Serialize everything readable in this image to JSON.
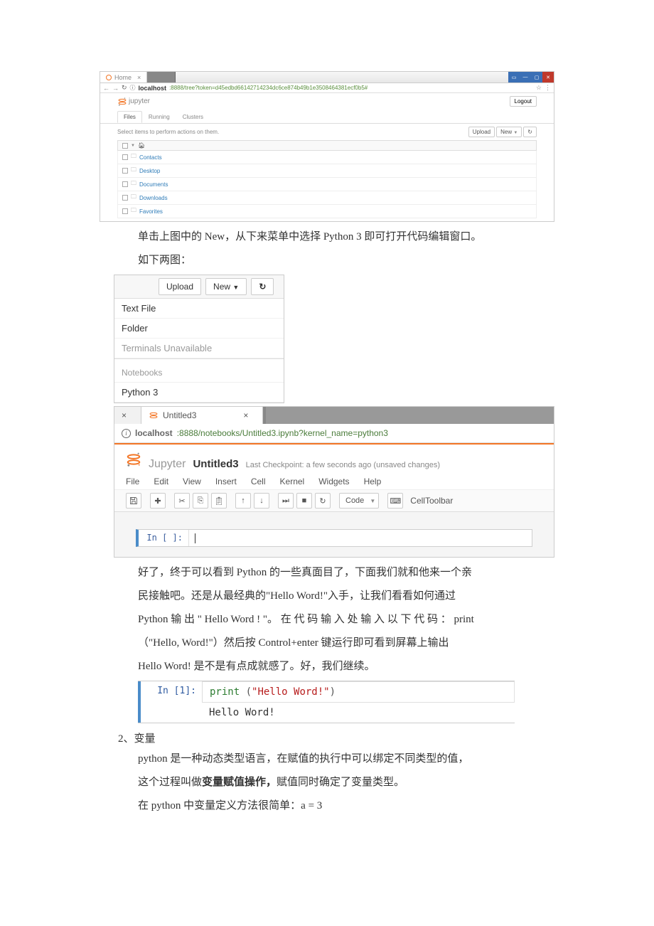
{
  "screenshot1": {
    "browser_tab": "Home",
    "url_label": "localhost",
    "url_rest": ":8888/tree?token=d45edbd66142714234dc6ce874b49b1e3508464381ecf0b5#",
    "logo": "jupyter",
    "logout": "Logout",
    "tabs": [
      "Files",
      "Running",
      "Clusters"
    ],
    "hint": "Select items to perform actions on them.",
    "upload": "Upload",
    "new": "New",
    "rows": [
      "Contacts",
      "Desktop",
      "Documents",
      "Downloads",
      "Favorites"
    ]
  },
  "text1a": "单击上图中的 New，从下来菜单中选择 Python 3 即可打开代码编辑窗口。",
  "text1b": "如下两图：",
  "screenshot2": {
    "upload": "Upload",
    "new": "New",
    "items": [
      "Text File",
      "Folder",
      "Terminals Unavailable"
    ],
    "section": "Notebooks",
    "py": "Python 3"
  },
  "screenshot3": {
    "tab_label": "Untitled3",
    "url_host": "localhost",
    "url_rest": ":8888/notebooks/Untitled3.ipynb?kernel_name=python3",
    "logo": "Jupyter",
    "title": "Untitled3",
    "checkpoint": "Last Checkpoint: a few seconds ago (unsaved changes)",
    "menu": [
      "File",
      "Edit",
      "View",
      "Insert",
      "Cell",
      "Kernel",
      "Widgets",
      "Help"
    ],
    "celltype": "Code",
    "celltoolbar": "CellToolbar",
    "prompt": "In [ ]:"
  },
  "text2a": "好了，终于可以看到 Python 的一些真面目了，下面我们就和他来一个亲",
  "text2b": "民接触吧。还是从最经典的\"Hello Word!\"入手，让我们看看如何通过",
  "text2c": "Python 输 出 \" Hello Word ! \"。 在 代 码 输 入 处 输 入 以 下 代 码 ： print",
  "text2d": "（\"Hello, Word!\"）然后按 Control+enter 键运行即可看到屏幕上输出",
  "text2e": "Hello Word! 是不是有点成就感了。好，我们继续。",
  "screenshot4": {
    "prompt": "In  [1]:",
    "code_fn": "print",
    "code_paren1": " (",
    "code_str": "\"Hello Word!\"",
    "code_paren2": ")",
    "output": "Hello Word!"
  },
  "heading2": "2、变量",
  "text3a": "python 是一种动态类型语言，在赋值的执行中可以绑定不同类型的值，",
  "text3b_a": "这个过程叫做",
  "text3b_b": "变量赋值操作，",
  "text3b_c": "赋值同时确定了变量类型。",
  "text3c": "在 python 中变量定义方法很简单：a = 3"
}
